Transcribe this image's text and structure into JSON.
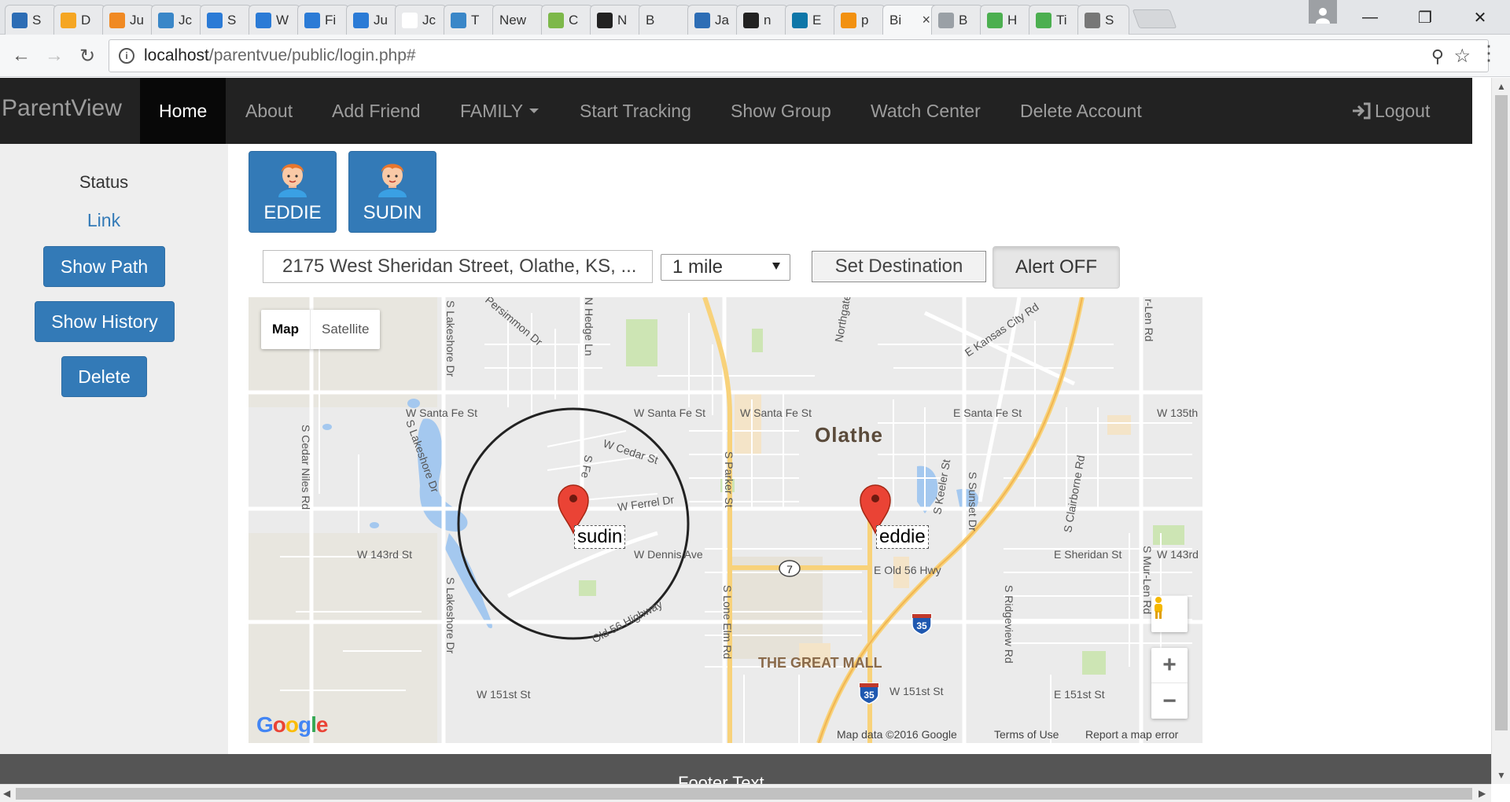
{
  "browser": {
    "tabs": [
      {
        "label": "S",
        "icon": "c-icon",
        "color": "#2d6db5"
      },
      {
        "label": "D",
        "icon": "shield-icon",
        "color": "#f5a623"
      },
      {
        "label": "Ju",
        "icon": "x-icon",
        "color": "#f08a24"
      },
      {
        "label": "Jc",
        "icon": "bulb-icon",
        "color": "#3a87c8"
      },
      {
        "label": "S",
        "icon": "info-icon",
        "color": "#2b7bd6"
      },
      {
        "label": "W",
        "icon": "info-icon",
        "color": "#2b7bd6"
      },
      {
        "label": "Fi",
        "icon": "info-icon",
        "color": "#2b7bd6"
      },
      {
        "label": "Ju",
        "icon": "info-icon",
        "color": "#2b7bd6"
      },
      {
        "label": "Jc",
        "icon": "blank-icon",
        "color": "#ffffff"
      },
      {
        "label": "T",
        "icon": "bulb-icon",
        "color": "#3a87c8"
      },
      {
        "label": "New",
        "icon": "none",
        "color": "#e9eaec"
      },
      {
        "label": "C",
        "icon": "leaf-icon",
        "color": "#7db84a"
      },
      {
        "label": "N",
        "icon": "github-icon",
        "color": "#222222"
      },
      {
        "label": "B",
        "icon": "none",
        "color": "#e9eaec"
      },
      {
        "label": "Ja",
        "icon": "c-icon",
        "color": "#2d6db5"
      },
      {
        "label": "n",
        "icon": "github-icon",
        "color": "#222222"
      },
      {
        "label": "E",
        "icon": "linkedin-icon",
        "color": "#0e76a8"
      },
      {
        "label": "p",
        "icon": "pma-icon",
        "color": "#f29111"
      },
      {
        "label": "Bi",
        "icon": "none",
        "color": "#f6f7f8"
      },
      {
        "label": "B",
        "icon": "page-icon",
        "color": "#9aa0a6"
      },
      {
        "label": "H",
        "icon": "w3-icon",
        "color": "#4caf50"
      },
      {
        "label": "Ti",
        "icon": "w3-icon",
        "color": "#4caf50"
      },
      {
        "label": "S",
        "icon": "gear-icon",
        "color": "#777777"
      }
    ],
    "url_host": "localhost",
    "url_path": "/parentvue/public/login.php#"
  },
  "nav": {
    "brand": "ParentView",
    "items": [
      {
        "label": "Home"
      },
      {
        "label": "About"
      },
      {
        "label": "Add Friend"
      },
      {
        "label": "FAMILY"
      },
      {
        "label": "Start Tracking"
      },
      {
        "label": "Show Group"
      },
      {
        "label": "Watch Center"
      },
      {
        "label": "Delete Account"
      }
    ],
    "logout": "Logout"
  },
  "sidebar": {
    "status": "Status",
    "link": "Link",
    "show_path": "Show Path",
    "show_history": "Show History",
    "delete": "Delete"
  },
  "children": [
    {
      "name": "EDDIE"
    },
    {
      "name": "SUDIN"
    }
  ],
  "controls": {
    "address_value": "2175 West Sheridan Street, Olathe, KS, ...",
    "radius_value": "1 mile",
    "set_destination": "Set Destination",
    "alert_toggle": "Alert OFF"
  },
  "map": {
    "type_map": "Map",
    "type_satellite": "Satellite",
    "city": "Olathe",
    "mall": "THE GREAT MALL",
    "streets": {
      "santa_fe_w1": "W Santa Fe St",
      "santa_fe_w2": "W Santa Fe St",
      "santa_fe_w3": "W Santa Fe St",
      "santa_fe_e": "E Santa Fe St",
      "w135": "W 135th",
      "cedar": "W Cedar St",
      "ferrel": "W Ferrel Dr",
      "dennis": "W Dennis Ave",
      "w143": "W 143rd St",
      "w143r": "W 143rd",
      "sheridan": "E Sheridan St",
      "old56": "E Old 56 Hwy",
      "old56hwy": "Old 56 Highway",
      "w151a": "W 151st St",
      "w151b": "W 151st St",
      "e151": "E 151st St",
      "parker": "S Parker St",
      "lone_elm": "S Lone Elm Rd",
      "lakeshore_n": "S Lakeshore Dr",
      "lakeshore_s": "S Lakeshore Dr",
      "lakeshore_mid": "S Lakeshore Dr",
      "cedar_niles": "S Cedar Niles Rd",
      "persimmon": "Persimmon Dr",
      "hedge": "N Hedge Ln",
      "kansas_city": "E Kansas City Rd",
      "northgate": "Northgate",
      "keeler": "S Keeler St",
      "sunset": "S Sunset Dr",
      "clairborne": "S Clairborne Rd",
      "mur_len": "S Mur-Len Rd",
      "mur_len_n": "r-Len Rd",
      "ridgeview": "S Ridgeview Rd",
      "ferrel_short": "S Fe"
    },
    "shields": {
      "route7": "7",
      "i35": "35"
    },
    "markers": [
      {
        "label": "sudin"
      },
      {
        "label": "eddie"
      }
    ],
    "google": [
      "G",
      "o",
      "o",
      "g",
      "l",
      "e"
    ],
    "google_colors": [
      "#4285f4",
      "#ea4335",
      "#fbbc05",
      "#4285f4",
      "#34a853",
      "#ea4335"
    ],
    "attribution": "Map data ©2016 Google",
    "terms": "Terms of Use",
    "report": "Report a map error"
  },
  "footer": {
    "text": "Footer Text"
  },
  "colors": {
    "navbar": "#222222",
    "primary": "#337ab7",
    "footer": "#555555",
    "marker": "#ea4335"
  }
}
